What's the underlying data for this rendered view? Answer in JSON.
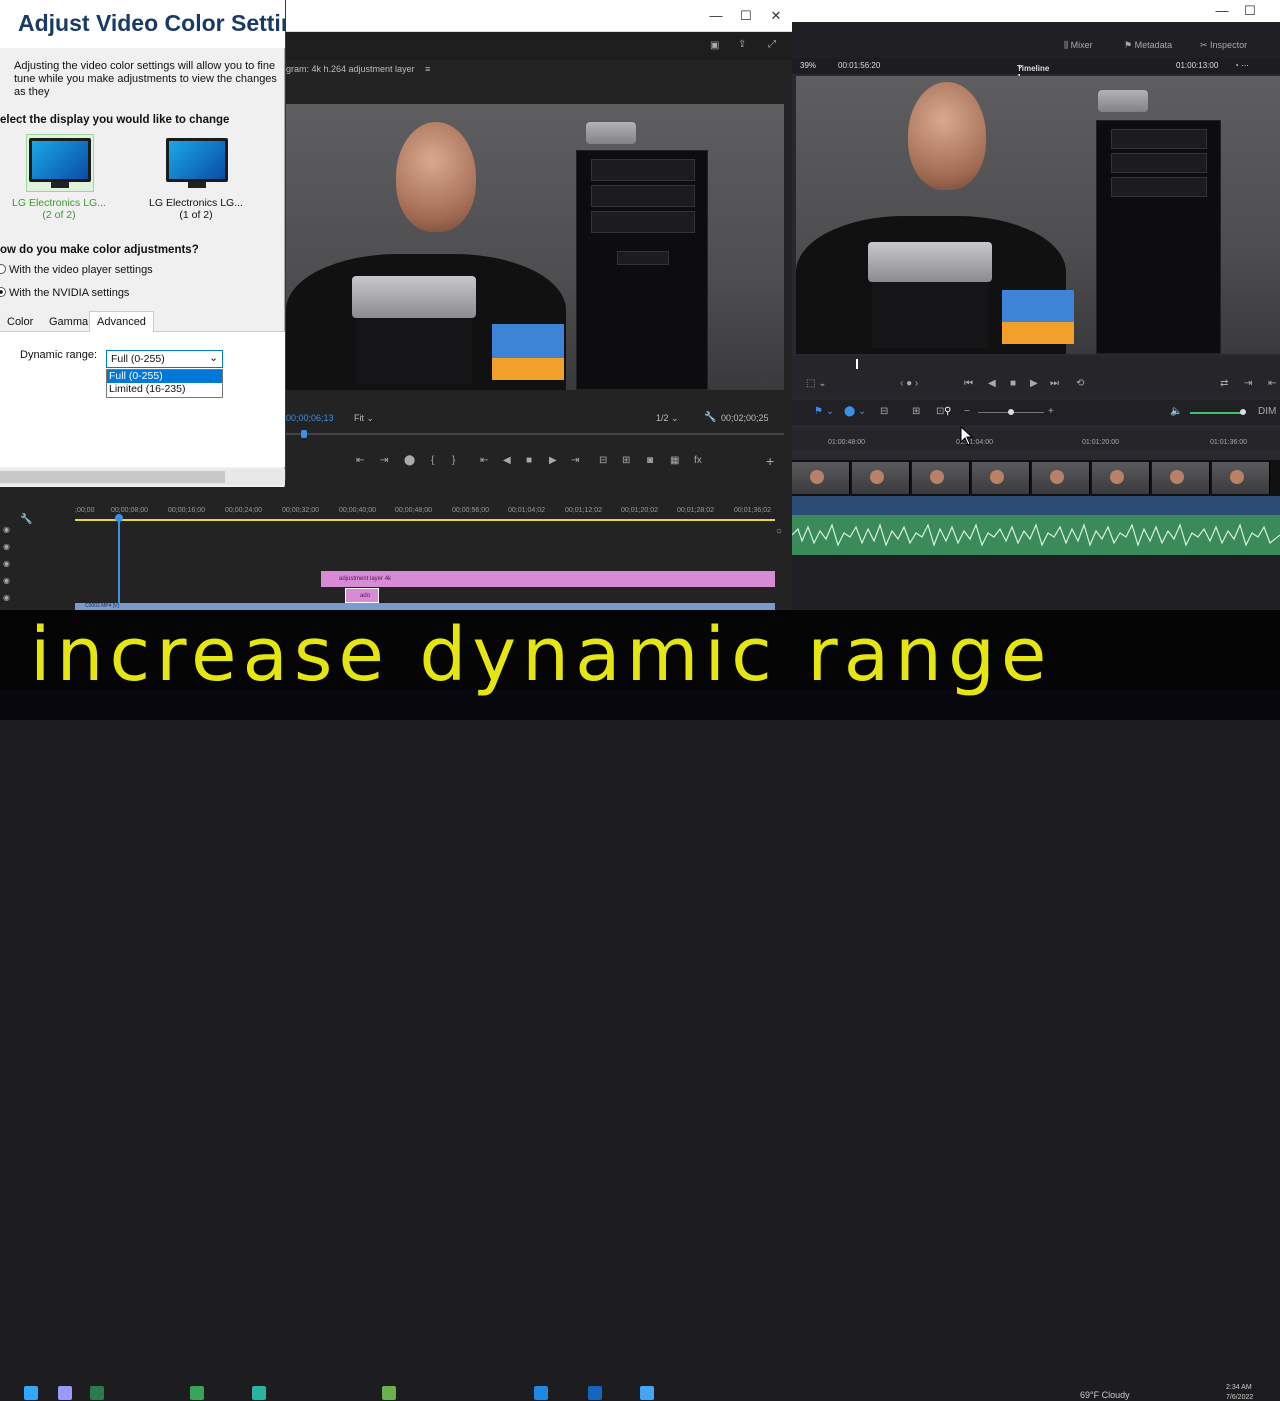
{
  "dialog": {
    "title": "Adjust Video Color Settings",
    "description": "Adjusting the video color settings will allow you to fine tune while you make adjustments to view the changes as they",
    "select_display_heading": "elect the display you would like to change",
    "monitors": [
      {
        "label": "LG Electronics LG...",
        "sublabel": "(2 of 2)",
        "selected": true
      },
      {
        "label": "LG Electronics LG...",
        "sublabel": "(1 of 2)",
        "selected": false
      }
    ],
    "adjust_heading": "ow do you make color adjustments?",
    "option_video_player": "With the video player settings",
    "option_nvidia": "With the NVIDIA settings",
    "tabs": [
      "Color",
      "Gamma",
      "Advanced"
    ],
    "active_tab": "Advanced",
    "dynamic_range_label": "Dynamic range:",
    "dynamic_range_value": "Full (0-255)",
    "dynamic_range_options": [
      "Full (0-255)",
      "Limited (16-235)"
    ]
  },
  "premiere": {
    "program_label": "gram: 4k h.264 adjustment layer",
    "timecode_current": "00;00;06;13",
    "fit_label": "Fit",
    "resolution": "1/2",
    "timecode_duration": "00;02;00;25",
    "ruler_ticks": [
      ";00;00",
      "00;00;08;00",
      "00;00;16;00",
      "00;00;24;00",
      "00;00;32;00",
      "00;00;40;00",
      "00;00;48;00",
      "00;00;56;00",
      "00;01;04;02",
      "00;01;12;02",
      "00;01;20;02",
      "00;01;28;02",
      "00;01;36;02"
    ],
    "clip_adjustment": "adjustment layer 4k",
    "clip_small": "ado",
    "clip_video": "C0002.MP4 [V]"
  },
  "resolve": {
    "buttons": [
      "Mixer",
      "Metadata",
      "Inspector"
    ],
    "zoom": "39%",
    "timecode_source": "00:01:56:20",
    "timeline_name": "Timeline 1",
    "timecode_record": "01:00:13:00",
    "ruler_ticks": [
      "01:00:48:00",
      "01:01:04:00",
      "01:01:20:00",
      "01:01:36:00"
    ]
  },
  "caption": "increase dynamic range",
  "taskbar": {
    "weather": "69°F Cloudy",
    "time": "2:34 AM",
    "date": "7/6/2022"
  },
  "colors": {
    "caption_text": "#e5e611",
    "clip_purple": "#d78bd6",
    "select_blue": "#0078d7",
    "audio_green": "#3a8a5a"
  }
}
